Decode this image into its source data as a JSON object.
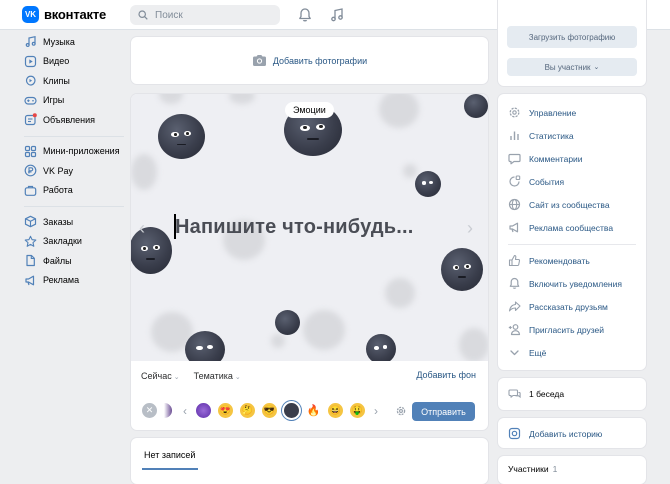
{
  "header": {
    "logo_mark": "VK",
    "logo_text": "вконтакте",
    "search_placeholder": "Поиск",
    "icons": [
      "bell-icon",
      "music-note-icon"
    ]
  },
  "nav": {
    "group1": [
      {
        "label": "Музыка",
        "icon": "music-icon"
      },
      {
        "label": "Видео",
        "icon": "video-icon"
      },
      {
        "label": "Клипы",
        "icon": "clips-icon"
      },
      {
        "label": "Игры",
        "icon": "gamepad-icon"
      },
      {
        "label": "Объявления",
        "icon": "ads-board-icon"
      }
    ],
    "group2": [
      {
        "label": "Мини-приложения",
        "icon": "apps-icon"
      },
      {
        "label": "VK Pay",
        "icon": "vkpay-icon"
      },
      {
        "label": "Работа",
        "icon": "briefcase-icon"
      }
    ],
    "group3": [
      {
        "label": "Заказы",
        "icon": "box-icon"
      },
      {
        "label": "Закладки",
        "icon": "star-icon"
      },
      {
        "label": "Файлы",
        "icon": "file-icon"
      },
      {
        "label": "Реклама",
        "icon": "megaphone-icon"
      }
    ]
  },
  "photo": {
    "label": "Добавить фотографии"
  },
  "post": {
    "tag": "Эмоции",
    "placeholder": "Напишите что-нибудь...",
    "time_option": "Сейчас",
    "topic_option": "Тематика",
    "add_bg": "Добавить фон",
    "send": "Отправить"
  },
  "wall": {
    "tab": "Нет записей"
  },
  "right": {
    "upload_photo": "Загрузить фотографию",
    "member_status": "Вы участник",
    "menu_group1": [
      {
        "label": "Управление",
        "icon": "gear-icon"
      },
      {
        "label": "Статистика",
        "icon": "bar-chart-icon"
      },
      {
        "label": "Комментарии",
        "icon": "comment-icon"
      },
      {
        "label": "События",
        "icon": "events-icon"
      },
      {
        "label": "Сайт из сообщества",
        "icon": "globe-icon"
      },
      {
        "label": "Реклама сообщества",
        "icon": "megaphone-icon"
      }
    ],
    "menu_group2": [
      {
        "label": "Рекомендовать",
        "icon": "thumbs-up-icon"
      },
      {
        "label": "Включить уведомления",
        "icon": "bell-icon"
      },
      {
        "label": "Рассказать друзьям",
        "icon": "share-icon"
      },
      {
        "label": "Пригласить друзей",
        "icon": "add-user-icon"
      },
      {
        "label": "Ещё",
        "icon": "chevron-down-icon"
      }
    ],
    "chat": "1 беседа",
    "story": "Добавить историю",
    "members_label": "Участники",
    "members_count": "1"
  },
  "colors": {
    "accent": "#5181b8",
    "link": "#2a5885",
    "brand": "#0077ff"
  }
}
